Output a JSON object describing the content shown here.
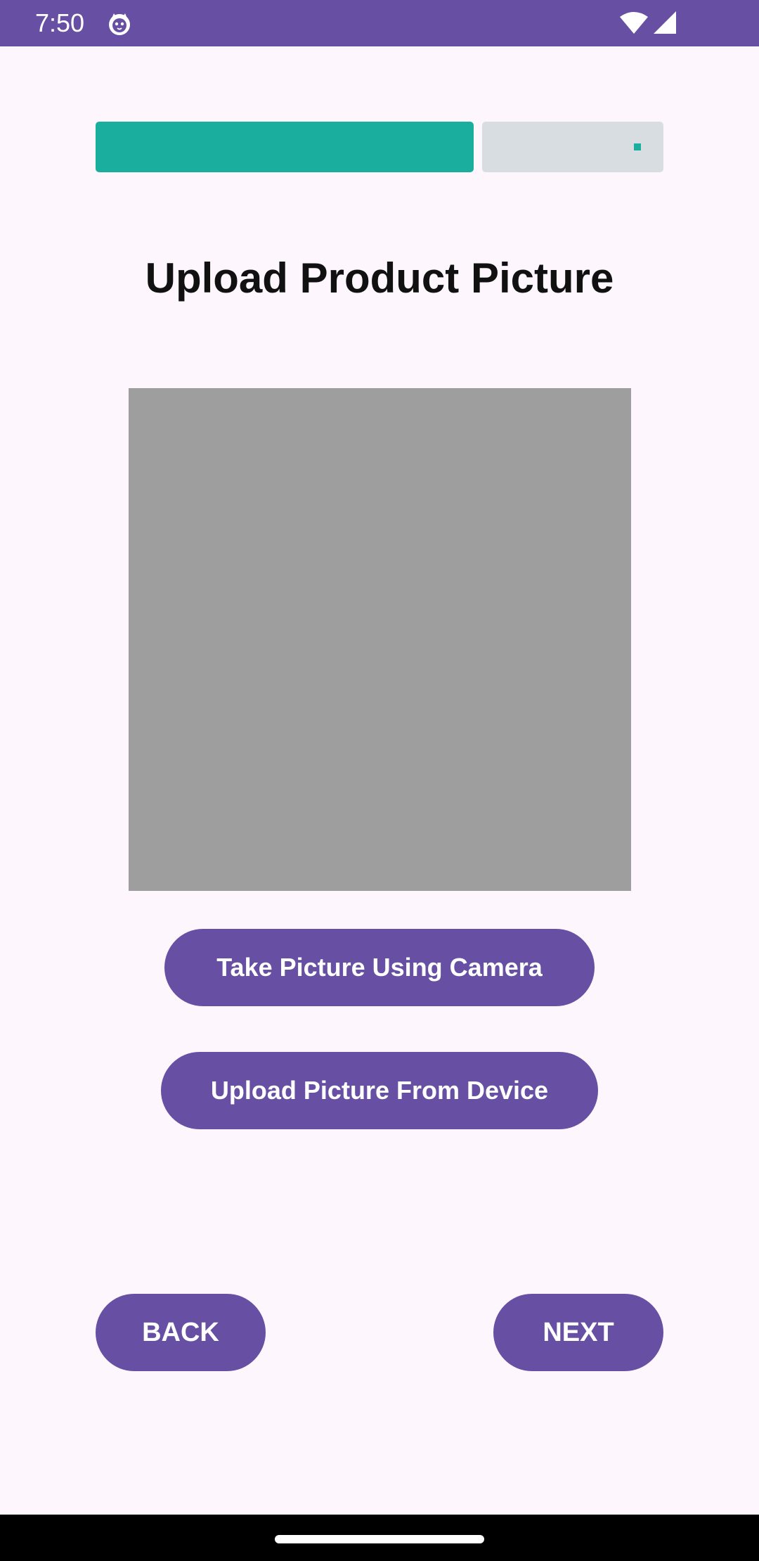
{
  "status_bar": {
    "time": "7:50",
    "background_color": "#6750a4",
    "icons": [
      "cat-notification-icon",
      "wifi-icon",
      "cellular-signal-icon"
    ]
  },
  "progress": {
    "fraction": 0.67,
    "fill_color": "#1aae9f",
    "track_color": "#d8dde2"
  },
  "page": {
    "title": "Upload Product Picture"
  },
  "buttons": {
    "take_picture": "Take Picture Using Camera",
    "upload_picture": "Upload Picture From Device",
    "back": "BACK",
    "next": "NEXT"
  },
  "colors": {
    "accent": "#6750a4",
    "background": "#fdf7fd",
    "image_placeholder": "#9e9e9e"
  }
}
